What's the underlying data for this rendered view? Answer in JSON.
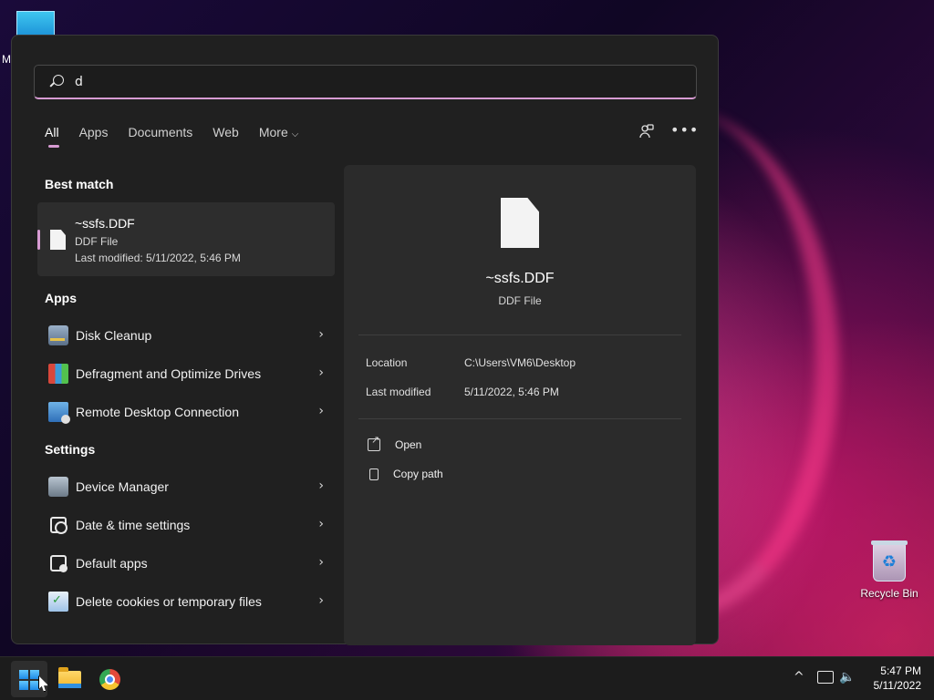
{
  "desktop": {
    "partial_label": "M",
    "recycle_bin_label": "Recycle Bin"
  },
  "search": {
    "query": "d",
    "tabs": [
      {
        "label": "All",
        "active": true
      },
      {
        "label": "Apps"
      },
      {
        "label": "Documents"
      },
      {
        "label": "Web"
      },
      {
        "label": "More"
      }
    ],
    "accent_color": "#d79bd2"
  },
  "best_match": {
    "section_title": "Best match",
    "name": "~ssfs.DDF",
    "type": "DDF File",
    "last_modified": "Last modified: 5/11/2022, 5:46 PM"
  },
  "apps": {
    "section_title": "Apps",
    "items": [
      {
        "label": "Disk Cleanup",
        "icon": "disk-cleanup-icon"
      },
      {
        "label": "Defragment and Optimize Drives",
        "icon": "defragment-icon"
      },
      {
        "label": "Remote Desktop Connection",
        "icon": "remote-desktop-icon"
      }
    ]
  },
  "settings": {
    "section_title": "Settings",
    "items": [
      {
        "label": "Device Manager",
        "icon": "device-manager-icon"
      },
      {
        "label": "Date & time settings",
        "icon": "date-time-icon"
      },
      {
        "label": "Default apps",
        "icon": "default-apps-icon"
      },
      {
        "label": "Delete cookies or temporary files",
        "icon": "delete-cookies-icon"
      }
    ]
  },
  "detail": {
    "name": "~ssfs.DDF",
    "type": "DDF File",
    "location_label": "Location",
    "location_value": "C:\\Users\\VM6\\Desktop",
    "modified_label": "Last modified",
    "modified_value": "5/11/2022, 5:46 PM",
    "actions": [
      {
        "label": "Open",
        "icon": "open-icon"
      },
      {
        "label": "Copy path",
        "icon": "copy-path-icon"
      }
    ]
  },
  "taskbar": {
    "time": "5:47 PM",
    "date": "5/11/2022"
  }
}
